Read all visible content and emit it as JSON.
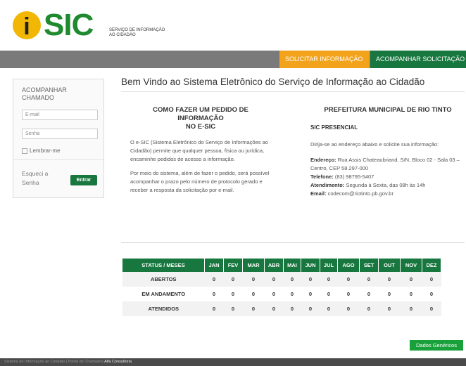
{
  "header": {
    "logo_i": "i",
    "logo_text": "SIC",
    "logo_subtitle_1": "SERVIÇO DE INFORMAÇÃO",
    "logo_subtitle_2": "AO CIDADÃO"
  },
  "nav": {
    "solicitar": "SOLICITAR INFORMAÇÃO",
    "acompanhar": "ACOMPANHAR SOLICITAÇÃO"
  },
  "sidebar": {
    "title_1": "ACOMPANHAR",
    "title_2": "CHAMADO",
    "email_placeholder": "E-mail",
    "senha_placeholder": "Senha",
    "remember_label": "Lembrar-me",
    "forgot_1": "Esqueci a",
    "forgot_2": "Senha",
    "enter_button": "Entrar"
  },
  "main": {
    "title": "Bem Vindo ao Sistema Eletrônico do Serviço de Informação ao Cidadão",
    "left": {
      "heading_1": "COMO FAZER UM PEDIDO DE INFORMAÇÃO",
      "heading_2": "NO E-SIC",
      "para1": "O e-SIC (Sistema Eletrônico do Serviço de Informações ao Cidadão) permite que qualquer pessoa, física ou jurídica, encaminhe pedidos de acesso a informação.",
      "para2": "Por meio do sistema, além de fazer o pedido, será possível acompanhar o prazo pelo número de protocolo gerado e receber a resposta da solicitação por e-mail."
    },
    "right": {
      "heading": "PREFEITURA MUNICIPAL DE RIO TINTO",
      "sic_presencial": "SIC PRESENCIAL",
      "intro": "Dirija-se ao endereço abaixo e solicite sua informação:",
      "address_label": "Endereço:",
      "address_value": "Rua Assis Chateaubriand, S/N, Bloco 02 - Sala 03 – Centro, CEP 58.297-000",
      "phone_label": "Telefone:",
      "phone_value": "(83) 98795-5407",
      "hours_label": "Atendimento:",
      "hours_value": "Segunda à Sexta, das 08h às 14h",
      "email_label": "Email:",
      "email_value": "codecom@riotinto.pb.gov.br"
    },
    "table": {
      "headers": [
        "STATUS / MESES",
        "JAN",
        "FEV",
        "MAR",
        "ABR",
        "MAI",
        "JUN",
        "JUL",
        "AGO",
        "SET",
        "OUT",
        "NOV",
        "DEZ"
      ],
      "rows": [
        {
          "label": "ABERTOS",
          "values": [
            "0",
            "0",
            "0",
            "0",
            "0",
            "0",
            "0",
            "0",
            "0",
            "0",
            "0",
            "0"
          ]
        },
        {
          "label": "EM ANDAMENTO",
          "values": [
            "0",
            "0",
            "0",
            "0",
            "0",
            "0",
            "0",
            "0",
            "0",
            "0",
            "0",
            "0"
          ]
        },
        {
          "label": "ATENDIDOS",
          "values": [
            "0",
            "0",
            "0",
            "0",
            "0",
            "0",
            "0",
            "0",
            "0",
            "0",
            "0",
            "0"
          ]
        }
      ]
    },
    "dados_button": "Dados Genéricos"
  },
  "footer": {
    "text": "Sistema de Informação ao Cidadão | Portal de Chamados",
    "brand": "Alfa Consultoria"
  }
}
